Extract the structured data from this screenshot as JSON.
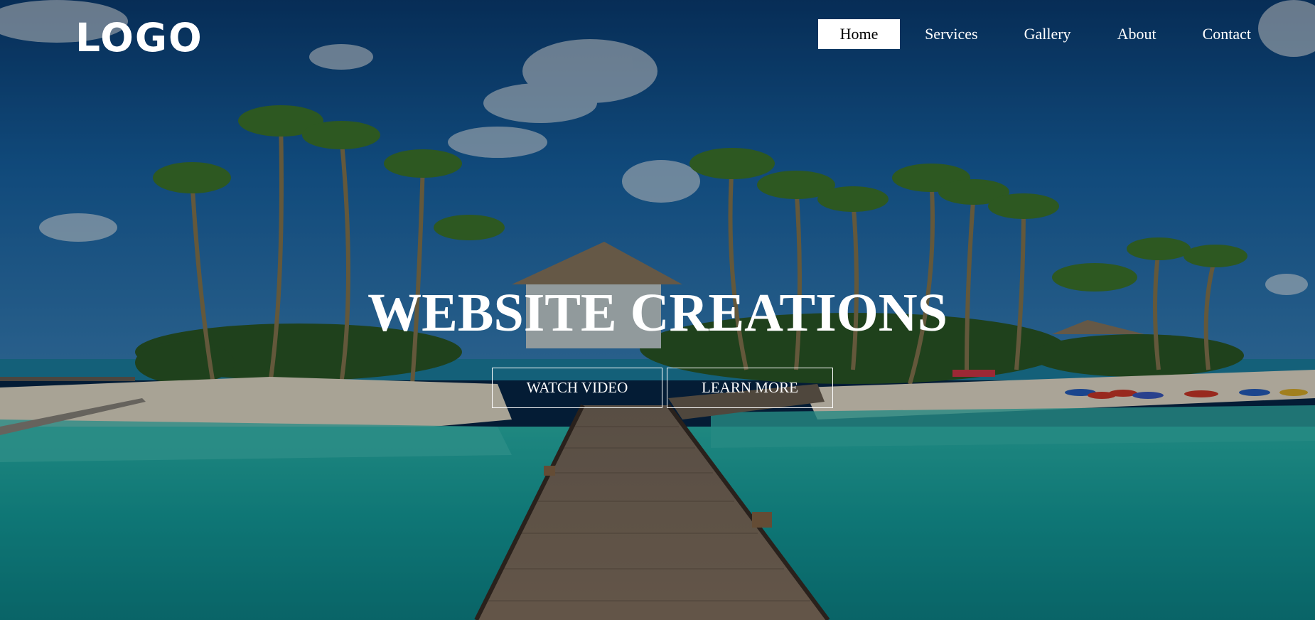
{
  "header": {
    "logo_text": "LOGO"
  },
  "nav": {
    "items": [
      {
        "label": "Home",
        "active": true
      },
      {
        "label": "Services",
        "active": false
      },
      {
        "label": "Gallery",
        "active": false
      },
      {
        "label": "About",
        "active": false
      },
      {
        "label": "Contact",
        "active": false
      }
    ]
  },
  "hero": {
    "title": "WEBSITE CREATIONS",
    "buttons": [
      {
        "label": "WATCH VIDEO"
      },
      {
        "label": "LEARN MORE"
      }
    ],
    "background_icon": "tropical-beach-photo"
  },
  "colors": {
    "sky": "#0f4f8a",
    "water": "#12a8a4",
    "text": "#ffffff",
    "active_nav_bg": "#ffffff",
    "active_nav_text": "#000000"
  }
}
